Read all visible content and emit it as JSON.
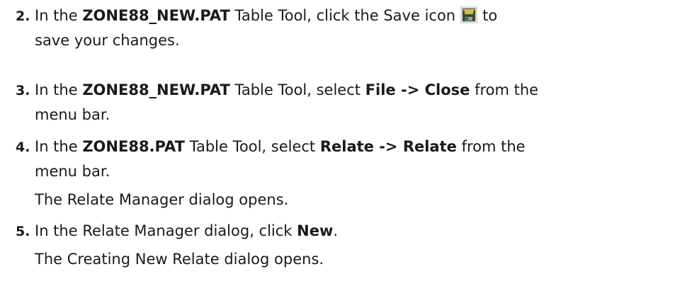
{
  "steps": [
    {
      "number": "2.",
      "l1_a": "In the ",
      "l1_b": "ZONE88_NEW.PAT",
      "l1_c": " Table Tool, click the Save icon",
      "l1_d": "to",
      "l2": "save your changes.",
      "icon": "save-icon"
    },
    {
      "number": "3.",
      "l1_a": "In the ",
      "l1_b": "ZONE88_NEW.PAT",
      "l1_c": " Table Tool, select ",
      "l1_d": "File -> Close",
      "l1_e": " from the",
      "l2": "menu bar."
    },
    {
      "number": "4.",
      "l1_a": "In the ",
      "l1_b": "ZONE88.PAT",
      "l1_c": " Table Tool, select ",
      "l1_d": "Relate -> Relate",
      "l1_e": " from the",
      "l2": "menu bar.",
      "result": "The Relate Manager dialog opens."
    },
    {
      "number": "5.",
      "l1_a": "In the Relate Manager dialog, click ",
      "l1_b": "New",
      "l1_c": ".",
      "result": "The Creating New Relate dialog opens."
    }
  ],
  "colors": {
    "text": "#1a1a1a",
    "icon_body": "#2f4f2f",
    "icon_label": "#e0b84a",
    "icon_frame": "#d9d9d9"
  }
}
